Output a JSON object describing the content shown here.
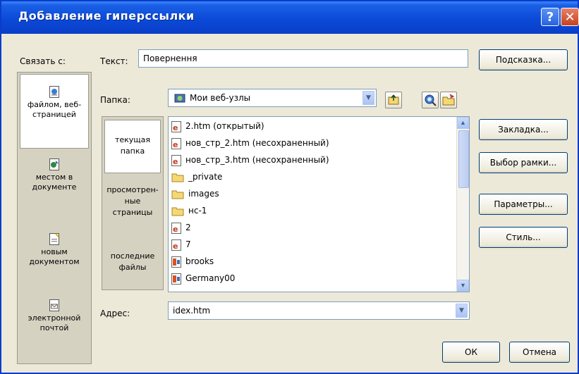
{
  "window": {
    "title": "Добавление гиперссылки"
  },
  "link_with": {
    "label": "Связать с:",
    "items": [
      {
        "label_line1": "файлом, веб-",
        "label_line2": "страницей",
        "icon": "web-page-icon"
      },
      {
        "label_line1": "местом в",
        "label_line2": "документе",
        "icon": "document-place-icon"
      },
      {
        "label_line1": "новым",
        "label_line2": "документом",
        "icon": "new-document-icon"
      },
      {
        "label_line1": "электронной",
        "label_line2": "почтой",
        "icon": "email-icon"
      }
    ]
  },
  "text_field": {
    "label": "Текст:",
    "value": "Повернення"
  },
  "folder": {
    "label": "Папка:",
    "value": "Мои веб-узлы"
  },
  "places": [
    {
      "line1": "текущая",
      "line2": "папка",
      "line3": ""
    },
    {
      "line1": "просмотрен-",
      "line2": "ные",
      "line3": "страницы"
    },
    {
      "line1": "последние",
      "line2": "файлы",
      "line3": ""
    }
  ],
  "files": [
    {
      "name": "2.htm (открытый)",
      "type": "html"
    },
    {
      "name": "нов_стр_2.htm (несохраненный)",
      "type": "html"
    },
    {
      "name": "нов_стр_3.htm (несохраненный)",
      "type": "html"
    },
    {
      "name": "_private",
      "type": "folder"
    },
    {
      "name": "images",
      "type": "folder"
    },
    {
      "name": "нс-1",
      "type": "folder"
    },
    {
      "name": "2",
      "type": "html"
    },
    {
      "name": "7",
      "type": "html"
    },
    {
      "name": "brooks",
      "type": "ppt"
    },
    {
      "name": "Germany00",
      "type": "ppt"
    }
  ],
  "address": {
    "label": "Адрес:",
    "value": "idex.htm"
  },
  "buttons": {
    "screentip": "Подсказка...",
    "bookmark": "Закладка...",
    "target_frame": "Выбор рамки...",
    "parameters": "Параметры...",
    "style": "Стиль...",
    "ok": "ОК",
    "cancel": "Отмена"
  },
  "colors": {
    "title_bar": "#0a48d6",
    "dialog_bg": "#ece9d8",
    "accent_border": "#7f9db9"
  }
}
